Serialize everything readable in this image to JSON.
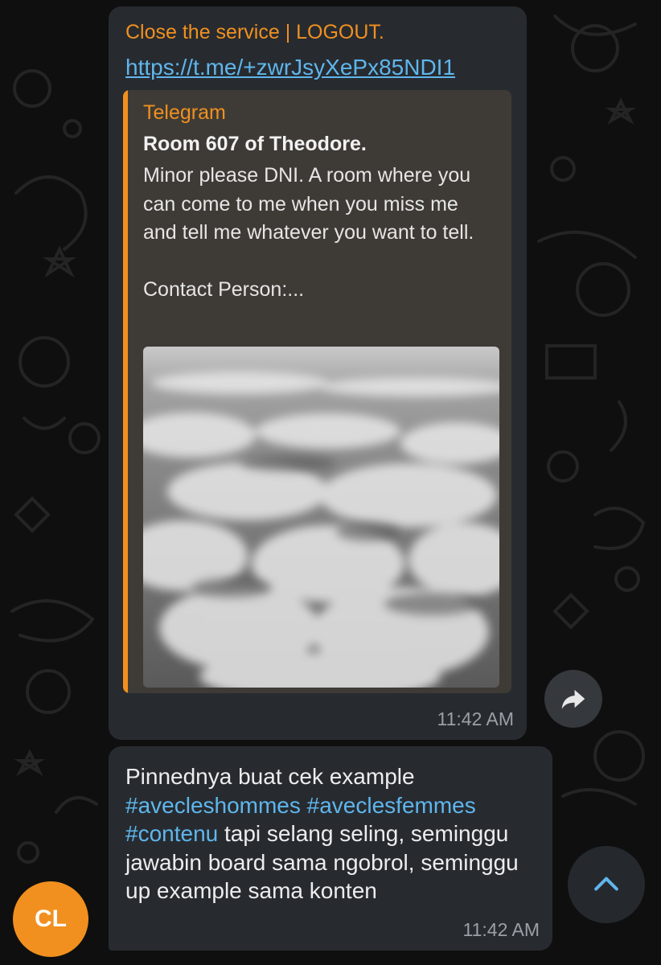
{
  "message1": {
    "sender": "Close the service | LOGOUT.",
    "link": "https://t.me/+zwrJsyXePx85NDI1",
    "preview": {
      "site": "Telegram",
      "title": "Room 607 of Theodore.",
      "description": "Minor please DNI. A room where you can come to me when you miss me and tell me whatever you want to tell.",
      "contact": "Contact Person:..."
    },
    "time": "11:42 AM"
  },
  "message2": {
    "text_intro": "Pinnednya buat cek example",
    "hashtag1": "#avecleshommes",
    "hashtag2": "#aveclesfemmes",
    "hashtag3": "#contenu",
    "text_rest": " tapi selang seling, seminggu jawabin board sama ngobrol, seminggu up example sama konten",
    "time": "11:42 AM"
  },
  "avatar": {
    "initials": "CL",
    "color": "#f1901f"
  },
  "icons": {
    "share": "share-arrow-icon",
    "scroll": "chevron-up-icon"
  },
  "colors": {
    "accent": "#f1901f",
    "link": "#5fb6ec",
    "bubble": "#272b30"
  }
}
